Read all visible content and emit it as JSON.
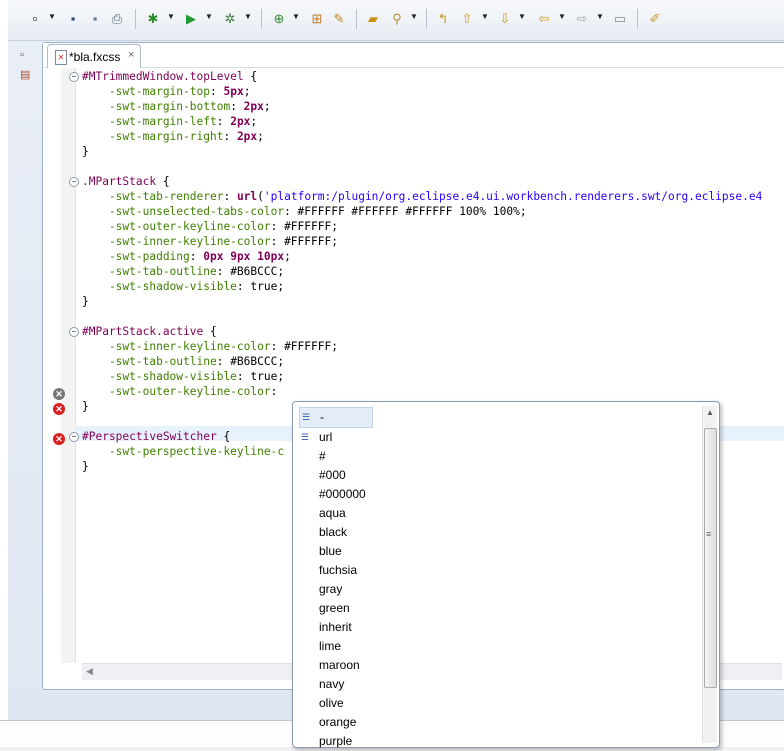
{
  "colors": {
    "selector": "#7f0055",
    "property": "#3f7f00",
    "string": "#2a00ff",
    "error": "#d82020"
  },
  "toolbar": {
    "icons": [
      "new-wizard-icon",
      "save-icon",
      "save-all-icon",
      "print-icon",
      "debug-icon",
      "run-icon",
      "external-tools-icon",
      "new-java-class-icon",
      "new-package-icon",
      "new-file-icon",
      "open-type-icon",
      "search-icon",
      "prev-annotation-icon",
      "next-annotation-icon",
      "last-edit-icon",
      "back-icon",
      "forward-icon",
      "pin-editor-icon",
      "paint-icon"
    ]
  },
  "editor": {
    "tab_label": "*bla.fxcss",
    "tab_close": "×",
    "code_lines": [
      {
        "fold": "−",
        "segments": [
          {
            "cls": "sel",
            "t": "#MTrimmedWindow.topLevel"
          },
          {
            "cls": "plain",
            "t": " {"
          }
        ]
      },
      {
        "segments": [
          {
            "cls": "prop",
            "t": "    -swt-margin-top"
          },
          {
            "cls": "plain",
            "t": ": "
          },
          {
            "cls": "num",
            "t": "5px"
          },
          {
            "cls": "plain",
            "t": ";"
          }
        ]
      },
      {
        "segments": [
          {
            "cls": "prop",
            "t": "    -swt-margin-bottom"
          },
          {
            "cls": "plain",
            "t": ": "
          },
          {
            "cls": "num",
            "t": "2px"
          },
          {
            "cls": "plain",
            "t": ";"
          }
        ]
      },
      {
        "segments": [
          {
            "cls": "prop",
            "t": "    -swt-margin-left"
          },
          {
            "cls": "plain",
            "t": ": "
          },
          {
            "cls": "num",
            "t": "2px"
          },
          {
            "cls": "plain",
            "t": ";"
          }
        ]
      },
      {
        "segments": [
          {
            "cls": "prop",
            "t": "    -swt-margin-right"
          },
          {
            "cls": "plain",
            "t": ": "
          },
          {
            "cls": "num",
            "t": "2px"
          },
          {
            "cls": "plain",
            "t": ";"
          }
        ]
      },
      {
        "segments": [
          {
            "cls": "plain",
            "t": "}"
          }
        ]
      },
      {
        "segments": []
      },
      {
        "fold": "−",
        "segments": [
          {
            "cls": "sel",
            "t": ".MPartStack"
          },
          {
            "cls": "plain",
            "t": " {"
          }
        ]
      },
      {
        "segments": [
          {
            "cls": "prop",
            "t": "    -swt-tab-renderer"
          },
          {
            "cls": "plain",
            "t": ": "
          },
          {
            "cls": "fn",
            "t": "url"
          },
          {
            "cls": "plain",
            "t": "("
          },
          {
            "cls": "str",
            "t": "'platform:/plugin/org.eclipse.e4.ui.workbench.renderers.swt/org.eclipse.e4"
          }
        ]
      },
      {
        "segments": [
          {
            "cls": "prop",
            "t": "    -swt-unselected-tabs-color"
          },
          {
            "cls": "plain",
            "t": ": #FFFFFF #FFFFFF #FFFFFF 100% 100%;"
          }
        ]
      },
      {
        "segments": [
          {
            "cls": "prop",
            "t": "    -swt-outer-keyline-color"
          },
          {
            "cls": "plain",
            "t": ": #FFFFFF;"
          }
        ]
      },
      {
        "segments": [
          {
            "cls": "prop",
            "t": "    -swt-inner-keyline-color"
          },
          {
            "cls": "plain",
            "t": ": #FFFFFF;"
          }
        ]
      },
      {
        "segments": [
          {
            "cls": "prop",
            "t": "    -swt-padding"
          },
          {
            "cls": "plain",
            "t": ": "
          },
          {
            "cls": "num",
            "t": "0px 9px 10px"
          },
          {
            "cls": "plain",
            "t": ";"
          }
        ]
      },
      {
        "segments": [
          {
            "cls": "prop",
            "t": "    -swt-tab-outline"
          },
          {
            "cls": "plain",
            "t": ": #B6BCCC;"
          }
        ]
      },
      {
        "segments": [
          {
            "cls": "prop",
            "t": "    -swt-shadow-visible"
          },
          {
            "cls": "plain",
            "t": ": true;"
          }
        ]
      },
      {
        "segments": [
          {
            "cls": "plain",
            "t": "}"
          }
        ]
      },
      {
        "segments": []
      },
      {
        "fold": "−",
        "segments": [
          {
            "cls": "sel",
            "t": "#MPartStack.active"
          },
          {
            "cls": "plain",
            "t": " {"
          }
        ]
      },
      {
        "segments": [
          {
            "cls": "prop",
            "t": "    -swt-inner-keyline-color"
          },
          {
            "cls": "plain",
            "t": ": #FFFFFF;"
          }
        ]
      },
      {
        "segments": [
          {
            "cls": "prop",
            "t": "    -swt-tab-outline"
          },
          {
            "cls": "plain",
            "t": ": #B6BCCC;"
          }
        ]
      },
      {
        "segments": [
          {
            "cls": "prop",
            "t": "    -swt-shadow-visible"
          },
          {
            "cls": "plain",
            "t": ": true;"
          }
        ]
      },
      {
        "segments": [
          {
            "cls": "prop",
            "t": "    -swt-outer-keyline-color"
          },
          {
            "cls": "plain",
            "t": ":"
          }
        ]
      },
      {
        "segments": [
          {
            "cls": "plain",
            "t": "}"
          }
        ]
      },
      {
        "segments": []
      },
      {
        "fold": "−",
        "segments": [
          {
            "cls": "sel",
            "t": "#PerspectiveSwitcher"
          },
          {
            "cls": "plain",
            "t": " {"
          }
        ]
      },
      {
        "segments": [
          {
            "cls": "prop",
            "t": "    -swt-perspective-keyline-c"
          }
        ]
      },
      {
        "segments": [
          {
            "cls": "plain",
            "t": "}"
          }
        ]
      }
    ]
  },
  "completion": {
    "items": [
      "-",
      "url",
      "#",
      "#000",
      "#000000",
      "aqua",
      "black",
      "blue",
      "fuchsia",
      "gray",
      "green",
      "inherit",
      "lime",
      "maroon",
      "navy",
      "olive",
      "orange",
      "purple"
    ],
    "selected_index": 0
  }
}
